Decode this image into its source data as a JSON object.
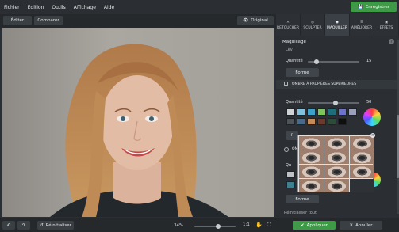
{
  "menu": [
    "Fichier",
    "Edition",
    "Outils",
    "Affichage",
    "Aide"
  ],
  "save_label": "Enregistrer",
  "toolbar": {
    "edit": "Éditer",
    "compare": "Comparer",
    "original": "Original"
  },
  "tabs": [
    {
      "label": "RETOUCHER",
      "icon": "bandage-icon"
    },
    {
      "label": "SCULPTER",
      "icon": "target-icon"
    },
    {
      "label": "MAQUILLER",
      "icon": "palette-icon"
    },
    {
      "label": "AMÉLIORER",
      "icon": "sliders-icon"
    },
    {
      "label": "EFFETS",
      "icon": "effects-icon"
    }
  ],
  "panel": {
    "title": "Maquillage",
    "cut_label": "Lèv",
    "qty_label": "Quantité",
    "qty1": "15",
    "forme": "Forme",
    "section": "OMBRE À PAUPIÈRES SUPÉRIEURES",
    "qty2": "50",
    "section2": "OM",
    "reset_all": "Réinitialiser tout"
  },
  "swatches_row1": [
    "#cfd3d6",
    "#7fc3dc",
    "#3fa0c8",
    "#7ec459",
    "#1e6f7a",
    "#6a74c8",
    "#9aa0b8"
  ],
  "swatches_row2": [
    "#4e545a",
    "#4a6a8a",
    "#c48a58",
    "#6b3a2a",
    "#2d4a3a",
    "#0f0f10"
  ],
  "swatches_row3": [
    "#bfc2c5"
  ],
  "bottom": {
    "reset": "Réinitialiser",
    "zoom": "34%",
    "one": "1:1",
    "apply": "Appliquer",
    "cancel": "Annuler"
  },
  "popup_count": 12
}
